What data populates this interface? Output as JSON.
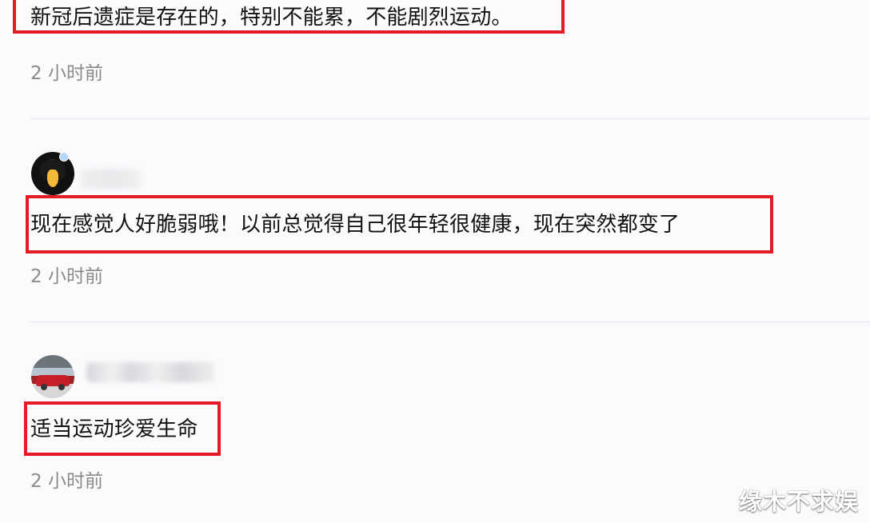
{
  "comments": [
    {
      "text": "新冠后遗症是存在的，特别不能累，不能剧烈运动。",
      "time": "2 小时前",
      "highlight_color": "#e31b23"
    },
    {
      "avatar": "cartoon-avatar-icon",
      "username": "",
      "text": "现在感觉人好脆弱哦！以前总觉得自己很年轻很健康，现在突然都变了",
      "time": "2 小时前",
      "highlight_color": "#e31b23"
    },
    {
      "avatar": "red-car-avatar-icon",
      "username": "",
      "text": "适当运动珍爱生命",
      "time": "2 小时前",
      "highlight_color": "#e31b23"
    }
  ],
  "watermark": "缘木不求娱",
  "colors": {
    "background": "#fbfbfd",
    "text": "#111111",
    "time": "#8b8b8b",
    "divider": "#e6e6ea",
    "highlight": "#e31b23"
  }
}
